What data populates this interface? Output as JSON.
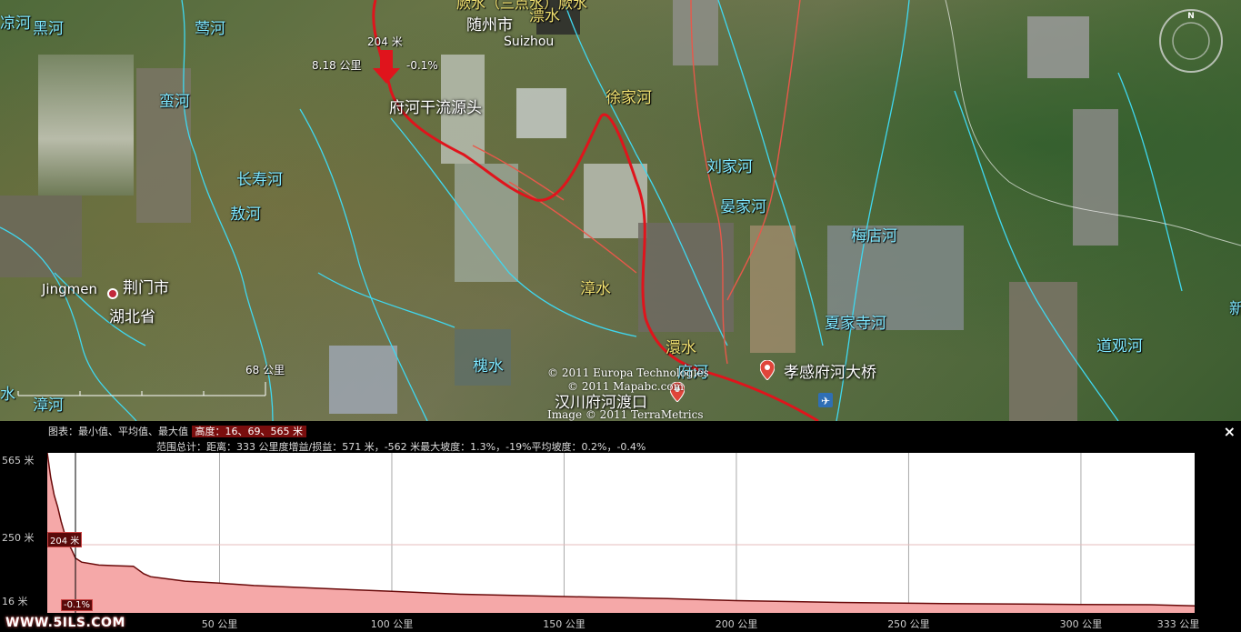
{
  "map": {
    "rivers": [
      {
        "name": "凉河"
      },
      {
        "name": "黑河"
      },
      {
        "name": "莺河"
      },
      {
        "name": "蛮河"
      },
      {
        "name": "长寿河"
      },
      {
        "name": "敖河"
      },
      {
        "name": "漳河"
      },
      {
        "name": "水"
      },
      {
        "name": "槐水"
      },
      {
        "name": "漂水"
      },
      {
        "name": "徐家河"
      },
      {
        "name": "刘家河"
      },
      {
        "name": "晏家河"
      },
      {
        "name": "梅店河"
      },
      {
        "name": "漳水"
      },
      {
        "name": "澴水"
      },
      {
        "name": "府河"
      },
      {
        "name": "夏家寺河"
      },
      {
        "name": "道观河"
      },
      {
        "name": "新"
      }
    ],
    "top_river_label": "厥水（三点水）厥水",
    "cities": {
      "suizhou_cn": "随州市",
      "suizhou_en": "Suizhou",
      "jingmen_en": "Jingmen",
      "jingmen_cn": "荆门市",
      "province": "湖北省"
    },
    "source_label": "府河干流源头",
    "marker_readout": {
      "elevation": "204 米",
      "distance": "8.18 公里",
      "grade": "-0.1%"
    },
    "bridge_label": "孝感府河大桥",
    "mouth_label": "汉川府河渡口",
    "scale_label": "68 公里",
    "copyright": [
      "© 2011 Europa Technologies",
      "© 2011 Mapabc.com",
      "Image © 2011 TerraMetrics"
    ],
    "colors": {
      "track": "#e0141c",
      "boundary": "#e8584a",
      "river": "#3fd8f0"
    }
  },
  "profile": {
    "header_line1_prefix": "图表：最小值、平均值、最大值",
    "header_line1_highlight": "高度：16、69、565 米",
    "header_line2": "范围总计：距离：333 公里度增益/损益：571 米，-562 米最大坡度：1.3%，-19%平均坡度：0.2%，-0.4%",
    "close_label": "×",
    "y_ticks": [
      "565 米",
      "250 米",
      "16 米"
    ],
    "x_ticks": [
      "50 公里",
      "100 公里",
      "150 公里",
      "200 公里",
      "250 公里",
      "300 公里",
      "333 公里"
    ],
    "cursor_elevation": "204 米",
    "cursor_grade": "-0.1%",
    "watermark": "WWW.5ILS.COM"
  },
  "chart_data": {
    "type": "area",
    "title": "",
    "xlabel": "",
    "ylabel": "",
    "x_unit": "公里",
    "y_unit": "米",
    "xlim": [
      0,
      333
    ],
    "ylim": [
      16,
      565
    ],
    "grid": true,
    "series": [
      {
        "x": [
          0,
          1,
          2,
          3,
          4,
          5,
          6,
          7,
          8.18,
          10,
          15,
          20,
          25,
          28,
          30,
          40,
          50,
          60,
          80,
          100,
          120,
          150,
          180,
          200,
          230,
          260,
          300,
          320,
          333
        ],
        "values": [
          565,
          480,
          420,
          380,
          330,
          290,
          255,
          235,
          204,
          190,
          180,
          178,
          176,
          150,
          140,
          125,
          118,
          110,
          100,
          90,
          80,
          72,
          65,
          58,
          52,
          48,
          45,
          44,
          40
        ]
      }
    ],
    "fill_color": "#f5a8a8",
    "line_color": "#6a0a0a"
  }
}
